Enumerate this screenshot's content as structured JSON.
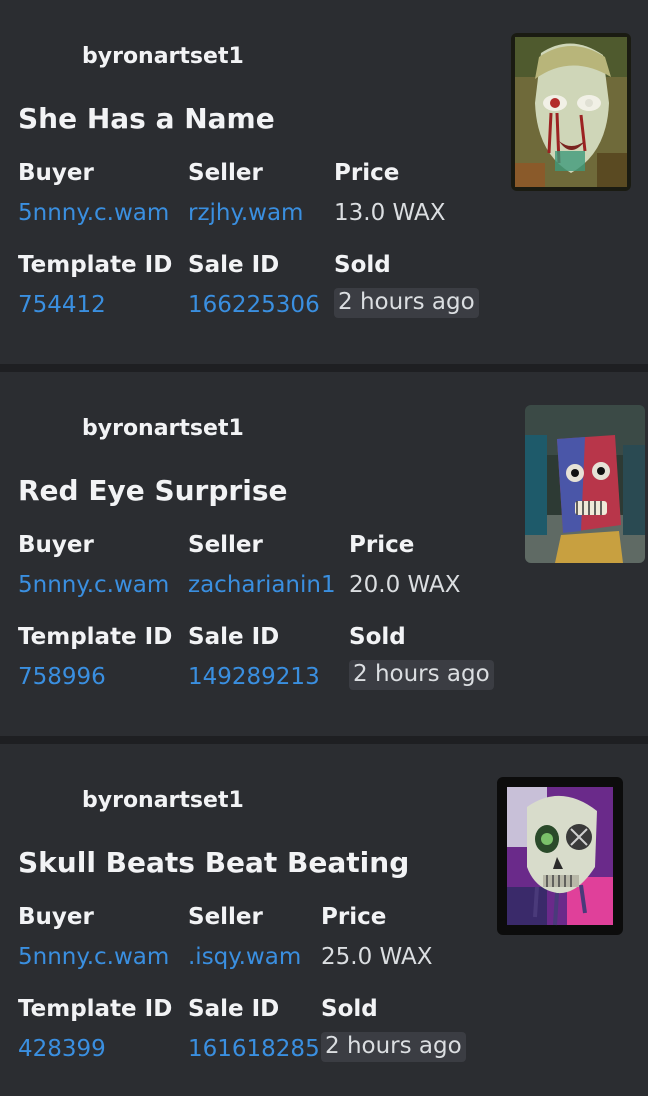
{
  "cards": [
    {
      "author": "byronartset1",
      "title": "She Has a Name",
      "labels": {
        "buyer": "Buyer",
        "seller": "Seller",
        "price": "Price",
        "template": "Template ID",
        "sale": "Sale ID",
        "sold": "Sold"
      },
      "buyer": "5nnny.c.wam",
      "seller": "rzjhy.wam",
      "price": "13.0 WAX",
      "template_id": "754412",
      "sale_id": "166225306",
      "sold": "2 hours ago",
      "thumbnail_icon": "pale-face-artwork"
    },
    {
      "author": "byronartset1",
      "title": "Red Eye Surprise",
      "labels": {
        "buyer": "Buyer",
        "seller": "Seller",
        "price": "Price",
        "template": "Template ID",
        "sale": "Sale ID",
        "sold": "Sold"
      },
      "buyer": "5nnny.c.wam",
      "seller": "zacharianin1",
      "price": "20.0 WAX",
      "template_id": "758996",
      "sale_id": "149289213",
      "sold": "2 hours ago",
      "thumbnail_icon": "red-face-artwork"
    },
    {
      "author": "byronartset1",
      "title": "Skull Beats Beat Beating",
      "labels": {
        "buyer": "Buyer",
        "seller": "Seller",
        "price": "Price",
        "template": "Template ID",
        "sale": "Sale ID",
        "sold": "Sold"
      },
      "buyer": "5nnny.c.wam",
      "seller": ".isqy.wam",
      "price": "25.0 WAX",
      "template_id": "428399",
      "sale_id": "161618285",
      "sold": "2 hours ago",
      "thumbnail_icon": "skull-artwork"
    }
  ],
  "colors": {
    "background": "#2b2d31",
    "link": "#3a8fe0",
    "separator": "#1e1f22"
  }
}
